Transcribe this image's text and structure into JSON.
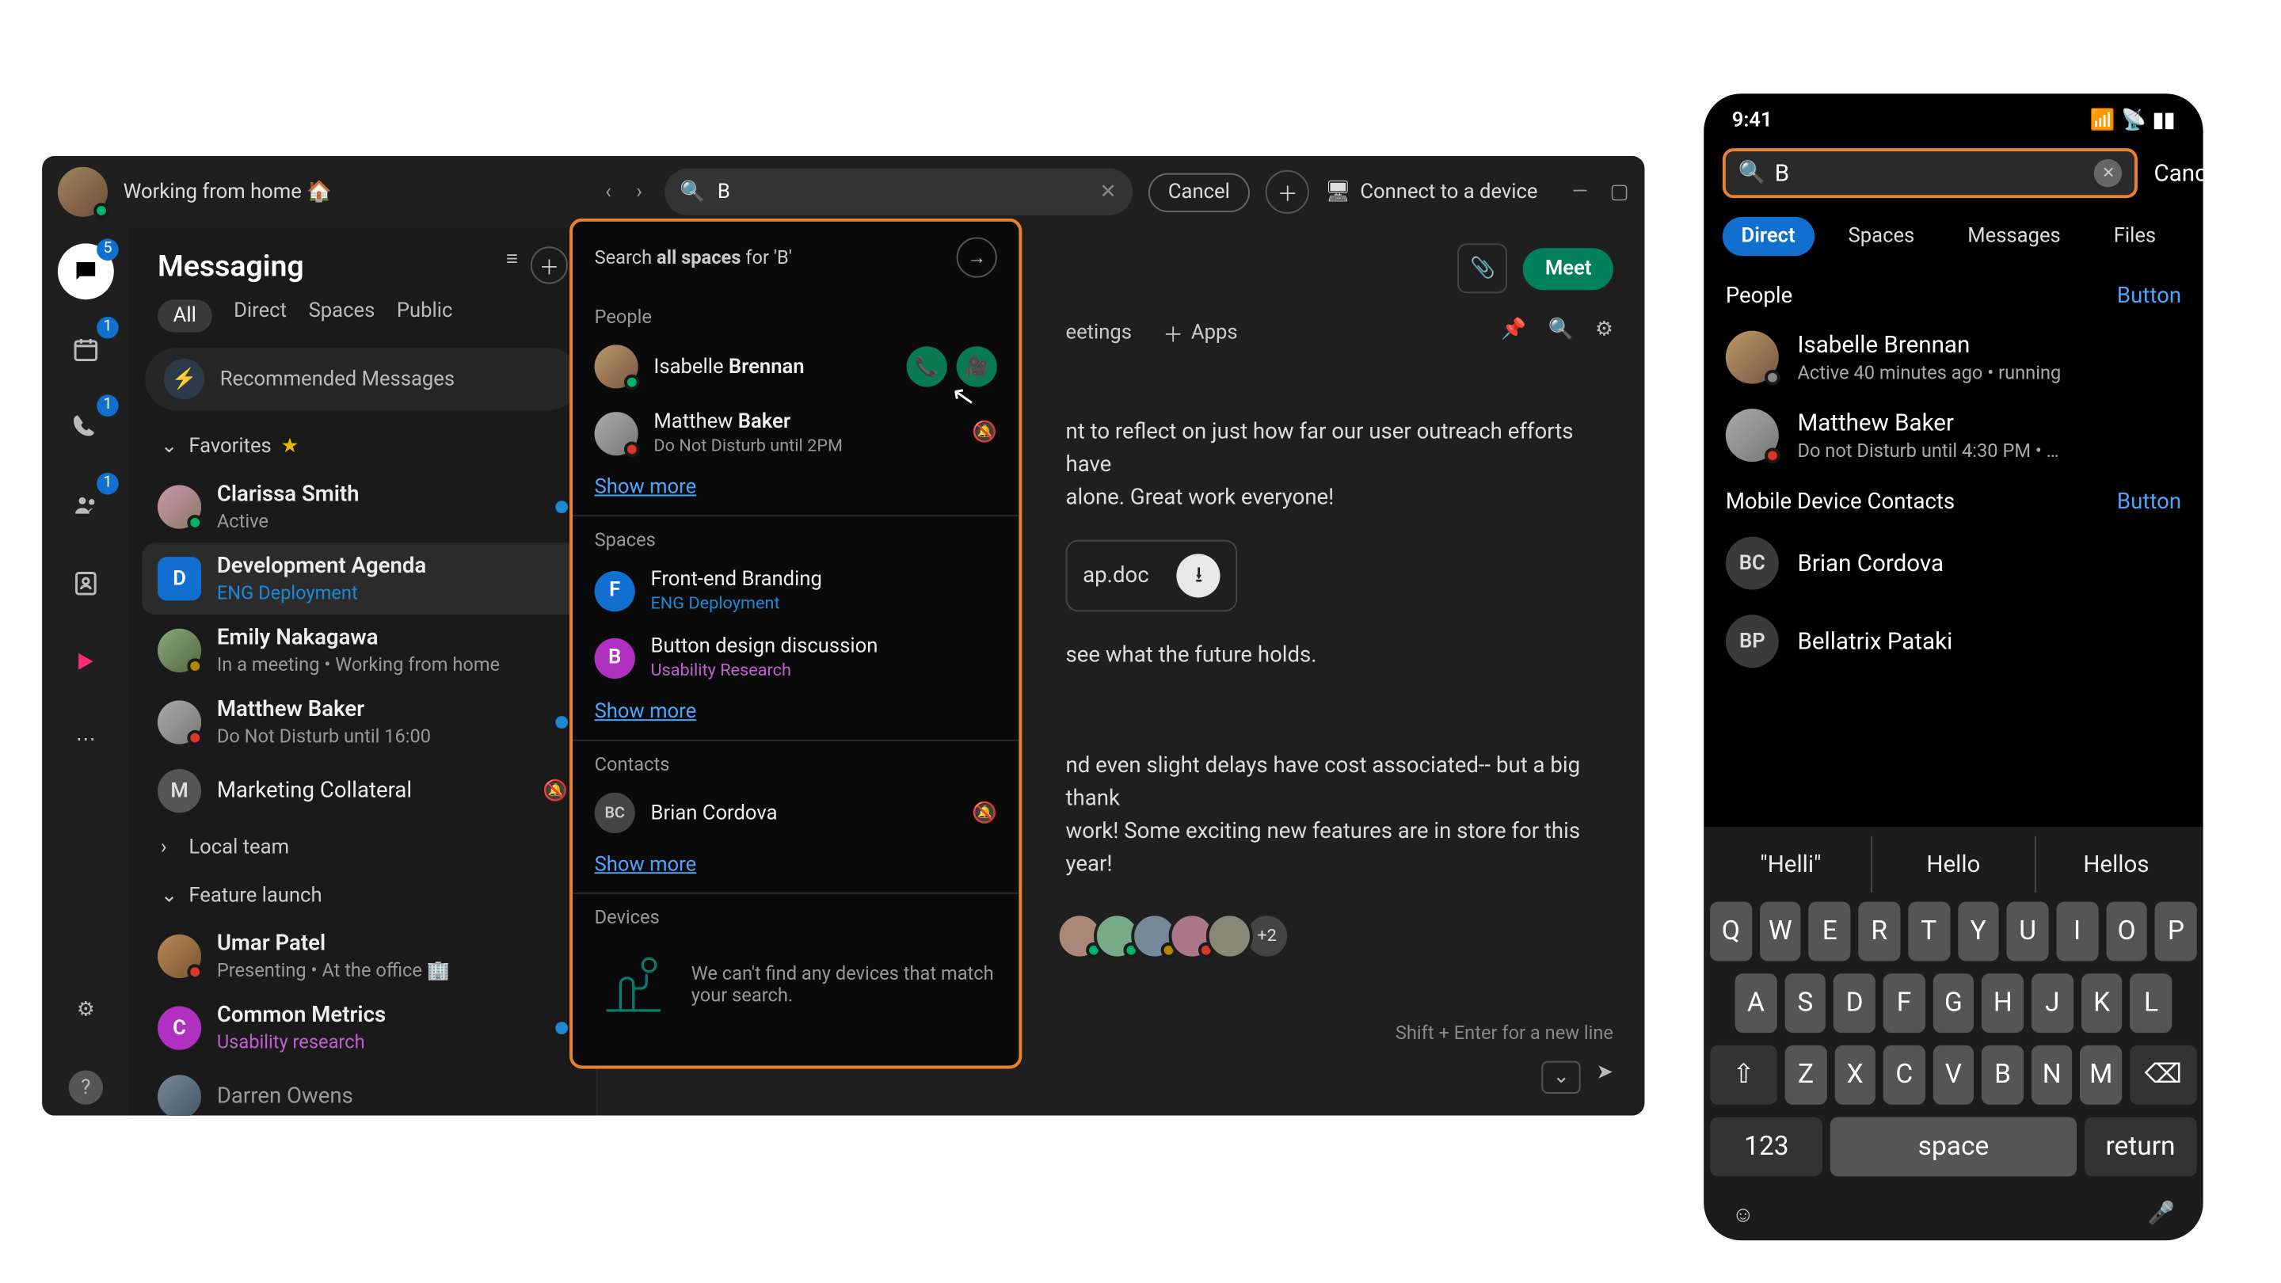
{
  "titlebar": {
    "status": "Working from home 🏠",
    "search_value": "B",
    "cancel": "Cancel",
    "connect": "Connect to a device"
  },
  "rail": {
    "badges": {
      "messaging": "5",
      "calendar": "1",
      "calls": "1",
      "teams": "1"
    }
  },
  "sidebar": {
    "title": "Messaging",
    "tabs": [
      "All",
      "Direct",
      "Spaces",
      "Public"
    ],
    "recommended": "Recommended Messages",
    "sections": {
      "favorites": "Favorites",
      "local": "Local team",
      "feature": "Feature launch"
    },
    "items": {
      "clarissa": {
        "name": "Clarissa Smith",
        "sub": "Active"
      },
      "devagenda": {
        "name": "Development Agenda",
        "sub": "ENG Deployment",
        "initial": "D",
        "color": "#1170cf"
      },
      "emily": {
        "name": "Emily Nakagawa",
        "sub": "In a meeting  •  Working from home"
      },
      "matthew": {
        "name": "Matthew Baker",
        "sub": "Do Not Disturb until 16:00"
      },
      "marketing": {
        "name": "Marketing Collateral",
        "initial": "M",
        "color": "#555"
      },
      "umar": {
        "name": "Umar Patel",
        "sub": "Presenting   •   At the office 🏢"
      },
      "metrics": {
        "name": "Common Metrics",
        "sub": "Usability research",
        "initial": "C",
        "color": "#b030c0"
      },
      "darren": {
        "name": "Darren Owens"
      }
    }
  },
  "main": {
    "tabs": {
      "meetings": "eetings",
      "apps": "Apps"
    },
    "meet": "Meet",
    "body1": "nt to reflect on just how far our user outreach efforts have",
    "body2": "alone. Great work everyone!",
    "file": "ap.doc",
    "body3": "see what the future holds.",
    "body4": "nd even slight delays have cost associated-- but a big thank",
    "body5": "work! Some exciting new features are in store for this year!",
    "more_av": "+2",
    "hint": "Shift + Enter for a new line"
  },
  "search_popup": {
    "head_pre": "Search ",
    "head_bold": "all spaces",
    "head_post": " for 'B'",
    "people": "People",
    "isabelle_pre": "Isabelle ",
    "isabelle_bold": "Brennan",
    "matthew_pre": "Matthew ",
    "matthew_bold": "Baker",
    "matthew_sub": "Do Not Disturb until 2PM",
    "showmore": "Show more",
    "spaces": "Spaces",
    "frontend": {
      "name": "Front-end Branding",
      "sub": "ENG Deployment",
      "initial": "F",
      "color": "#1170cf"
    },
    "button": {
      "name": "Button design discussion",
      "sub": "Usability Research",
      "initial": "B",
      "color": "#b030c0"
    },
    "contacts": "Contacts",
    "brian": {
      "name": "Brian Cordova",
      "initial": "BC"
    },
    "devices": "Devices",
    "devices_empty": "We can't find any devices that match your search."
  },
  "mobile": {
    "time": "9:41",
    "search_value": "B",
    "cancel": "Cancel",
    "tabs": [
      "Direct",
      "Spaces",
      "Messages",
      "Files"
    ],
    "people": "People",
    "button": "Button",
    "isabelle": {
      "name": "Isabelle Brennan",
      "sub": "Active 40 minutes ago • running"
    },
    "matthew": {
      "name": "Matthew Baker",
      "sub": "Do not Disturb until 4:30 PM • …"
    },
    "contacts": "Mobile Device Contacts",
    "brian": {
      "name": "Brian Cordova",
      "initial": "BC"
    },
    "bellatrix": {
      "name": "Bellatrix Pataki",
      "initial": "BP"
    },
    "sugg": [
      "\"Helli\"",
      "Hello",
      "Hellos"
    ],
    "kb": {
      "r1": [
        "Q",
        "W",
        "E",
        "R",
        "T",
        "Y",
        "U",
        "I",
        "O",
        "P"
      ],
      "r2": [
        "A",
        "S",
        "D",
        "F",
        "G",
        "H",
        "J",
        "K",
        "L"
      ],
      "r3": [
        "Z",
        "X",
        "C",
        "V",
        "B",
        "N",
        "M"
      ],
      "num": "123",
      "space": "space",
      "return": "return"
    }
  }
}
